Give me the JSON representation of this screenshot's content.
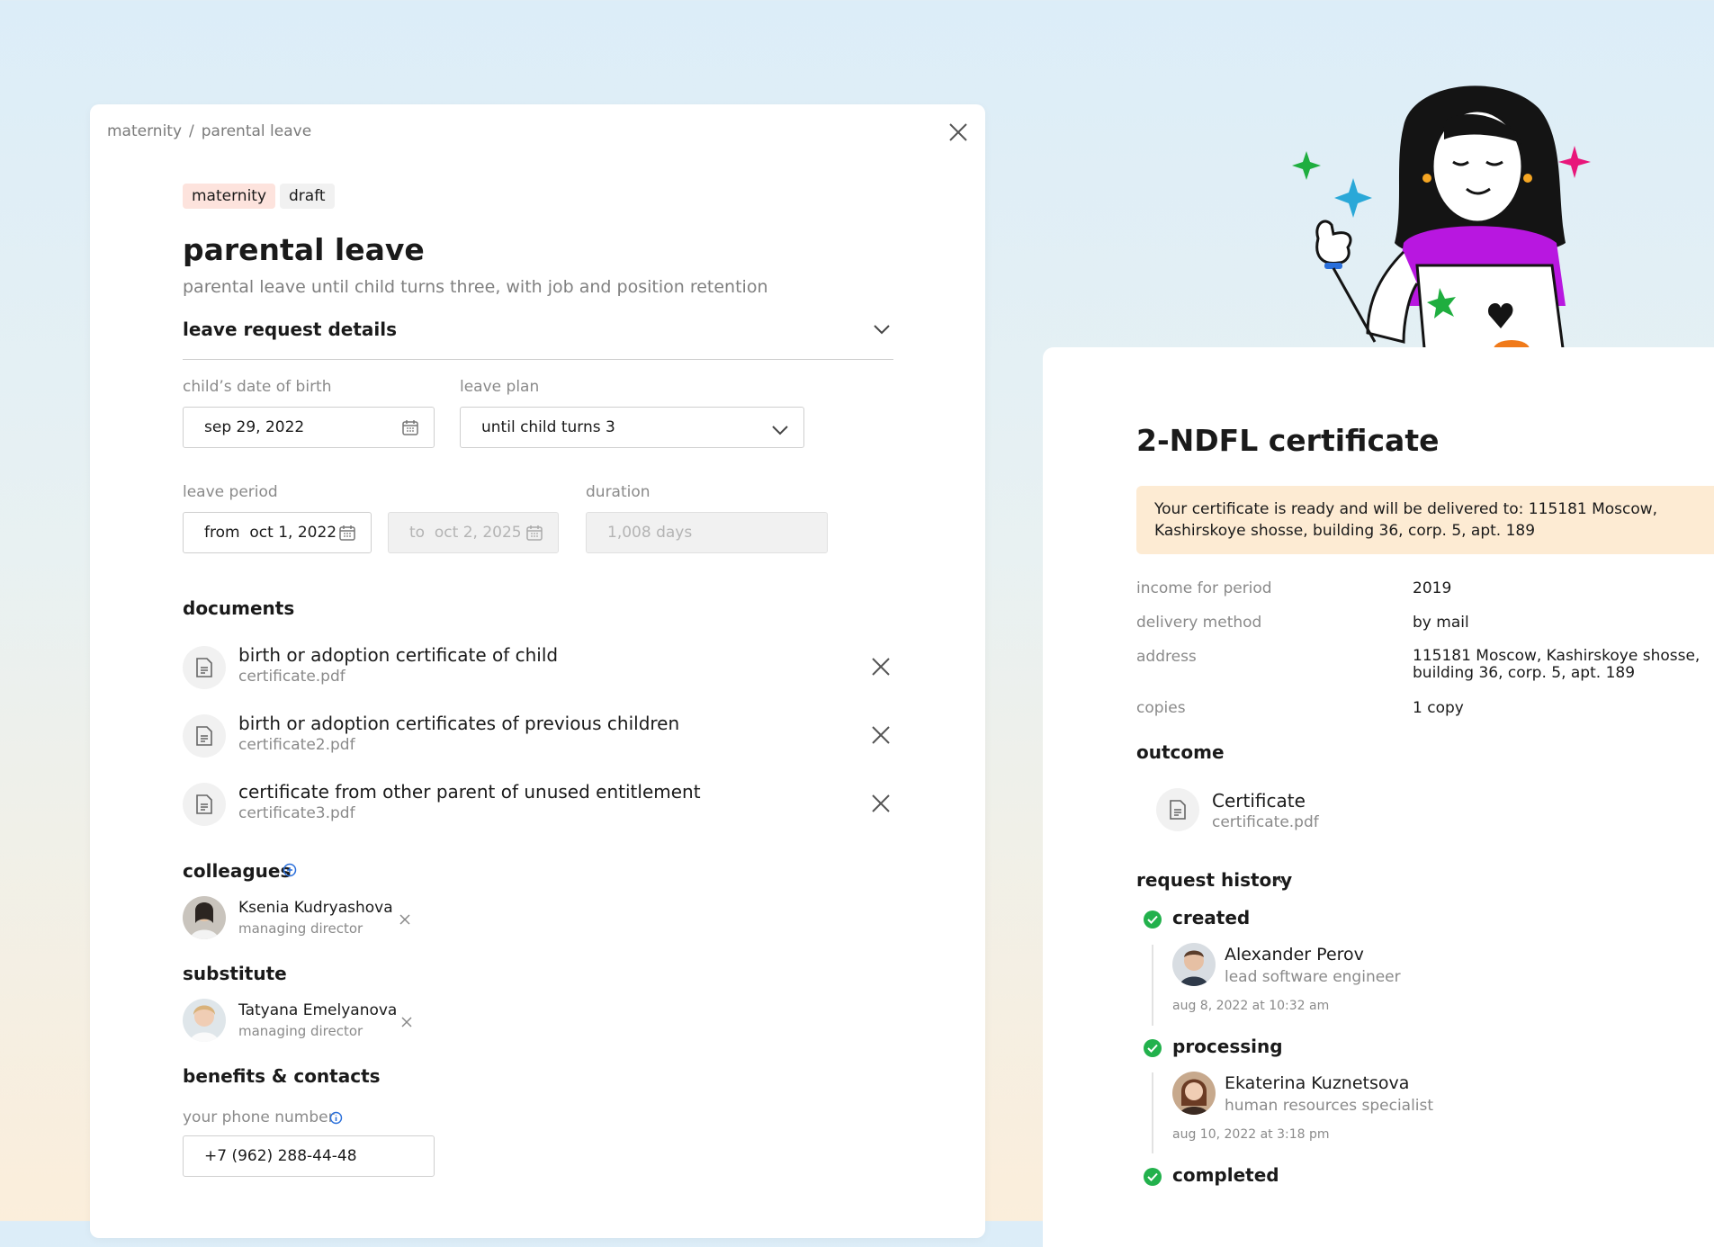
{
  "left": {
    "breadcrumb": [
      "maternity",
      "parental leave"
    ],
    "breadcrumb_sep": "/",
    "tags": [
      "maternity",
      "draft"
    ],
    "title": "parental leave",
    "subtitle": "parental leave until child turns three, with job and position retention",
    "details_header": "leave request details",
    "dob": {
      "label": "child’s date of birth",
      "value": "sep 29, 2022"
    },
    "plan": {
      "label": "leave plan",
      "value": "until child turns 3"
    },
    "period": {
      "label": "leave period",
      "from_prefix": "from",
      "from_value": "oct 1, 2022",
      "to_prefix": "to",
      "to_value": "oct 2, 2025"
    },
    "duration": {
      "label": "duration",
      "value": "1,008 days"
    },
    "documents_header": "documents",
    "documents": [
      {
        "title": "birth or adoption certificate of child",
        "file": "certificate.pdf"
      },
      {
        "title": "birth or adoption certificates of previous children",
        "file": "certificate2.pdf"
      },
      {
        "title": "certificate from other parent of unused entitlement",
        "file": "certificate3.pdf"
      }
    ],
    "colleagues_header": "colleagues",
    "colleague": {
      "name": "Ksenia Kudryashova",
      "role": "managing director"
    },
    "substitute_header": "substitute",
    "substitute": {
      "name": "Tatyana Emelyanova",
      "role": "managing director"
    },
    "benefits_header": "benefits & contacts",
    "phone": {
      "label": "your phone number",
      "value": "+7 (962) 288-44-48"
    }
  },
  "right": {
    "title": "2-NDFL certificate",
    "notice": "Your certificate is ready and will be delivered to: 115181 Moscow, Kashirskoye shosse, building 36, corp. 5, apt. 189",
    "details": [
      {
        "label": "income for period",
        "value": "2019"
      },
      {
        "label": "delivery method",
        "value": "by mail"
      },
      {
        "label": "address",
        "value": "115181 Moscow, Kashirskoye shosse, building 36, corp. 5, apt. 189"
      },
      {
        "label": "copies",
        "value": "1 copy"
      }
    ],
    "outcome_header": "outcome",
    "outcome": {
      "title": "Certificate",
      "file": "certificate.pdf"
    },
    "history_header": "request history",
    "history": [
      {
        "status": "created",
        "name": "Alexander Perov",
        "role": "lead software engineer",
        "time": "aug 8, 2022 at 10:32 am"
      },
      {
        "status": "processing",
        "name": "Ekaterina Kuznetsova",
        "role": "human resources specialist",
        "time": "aug 10, 2022 at 3:18 pm"
      },
      {
        "status": "completed"
      }
    ]
  },
  "colors": {
    "accent_blue": "#2a6fdb",
    "success_green": "#22b14c",
    "tag_pink": "#fde3dd",
    "notice_bg": "#fdebd3"
  }
}
